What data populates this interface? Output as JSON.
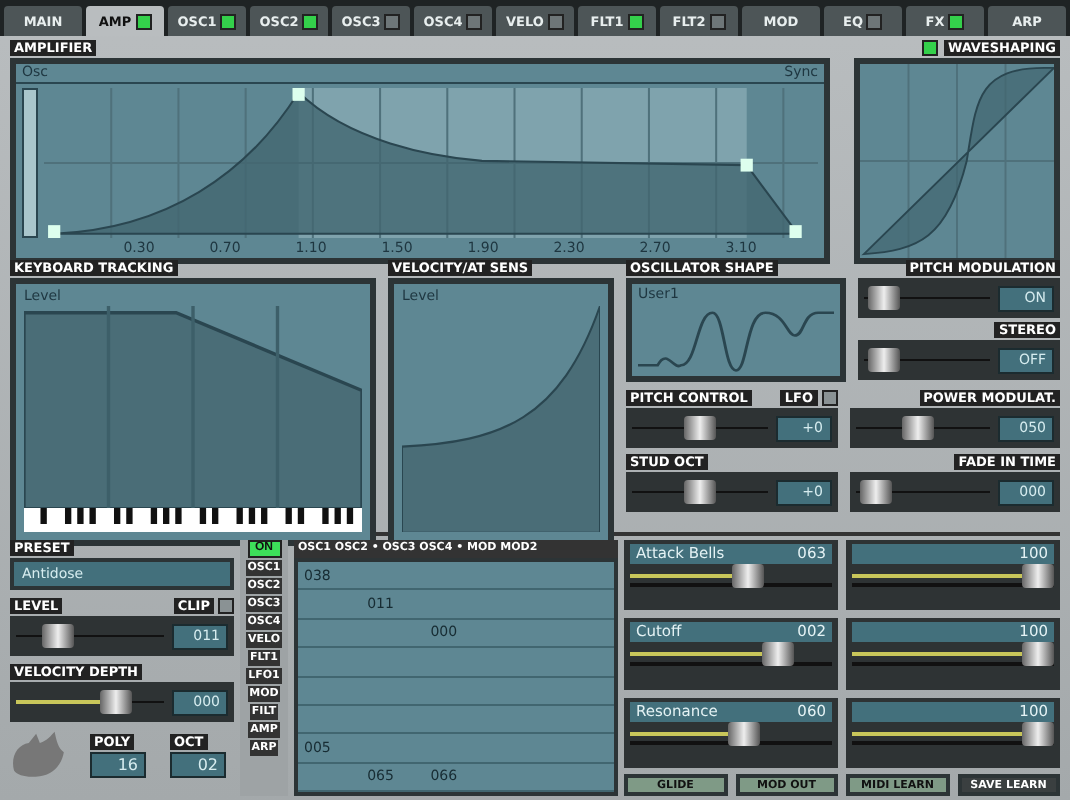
{
  "tabs": [
    {
      "label": "MAIN",
      "selected": false
    },
    {
      "label": "AMP",
      "selected": true,
      "toggle": true
    },
    {
      "label": "OSC1",
      "selected": false,
      "toggle": true
    },
    {
      "label": "OSC2",
      "selected": false,
      "toggle": true
    },
    {
      "label": "OSC3",
      "selected": false,
      "toggle": false
    },
    {
      "label": "OSC4",
      "selected": false,
      "toggle": false
    },
    {
      "label": "VELO",
      "selected": false,
      "toggle": false
    },
    {
      "label": "FLT1",
      "selected": false,
      "toggle": true
    },
    {
      "label": "FLT2",
      "selected": false,
      "toggle": false
    },
    {
      "label": "MOD",
      "selected": false
    },
    {
      "label": "EQ",
      "selected": false,
      "toggle": false
    },
    {
      "label": "FX",
      "selected": false,
      "toggle": true
    },
    {
      "label": "ARP",
      "selected": false
    }
  ],
  "amplifier": {
    "title": "AMPLIFIER",
    "envelope_label": "Osc",
    "sync_label": "Sync",
    "time_labels": [
      "0.30",
      "0.70",
      "1.10",
      "1.50",
      "1.90",
      "2.30",
      "2.70",
      "3.10"
    ]
  },
  "waveshaping": {
    "title": "WAVESHAPING",
    "enabled": true
  },
  "keyboard_tracking": {
    "title": "KEYBOARD TRACKING",
    "curve_label": "Level"
  },
  "velocity": {
    "title": "VELOCITY/AT SENS",
    "curve_label": "Level"
  },
  "oscillator_shape": {
    "title": "OSCILLATOR SHAPE",
    "name": "User1"
  },
  "right_sliders": [
    {
      "title": "PITCH MODULATION",
      "level": 0.04,
      "value": "ON"
    },
    {
      "title": "STEREO",
      "level": 0.04,
      "value": "OFF"
    }
  ],
  "mid_sliders": [
    {
      "title": "PITCH CONTROL",
      "level": 0.5,
      "value": "+0",
      "lfo_label": "LFO",
      "lfo": false
    },
    {
      "title": "STUD OCT",
      "level": 0.5,
      "value": "+0"
    }
  ],
  "mod_sliders": [
    {
      "title": "POWER MODULAT.",
      "level": 0.45,
      "value": "050"
    },
    {
      "title": "FADE IN TIME",
      "level": 0.04,
      "value": "000"
    }
  ],
  "preset": {
    "title": "PRESET",
    "name": "Antidose"
  },
  "level_slider": {
    "title": "LEVEL",
    "level": 0.22,
    "value": "011",
    "clip_label": "CLIP",
    "clip": false
  },
  "velocity_depth": {
    "title": "VELOCITY DEPTH",
    "level": 0.72,
    "value": "000"
  },
  "small_values": [
    {
      "label": "POLY",
      "value": "16"
    },
    {
      "label": "OCT",
      "value": "02"
    }
  ],
  "step_toggle": {
    "label": "ON",
    "on": true
  },
  "step_list": [
    "OSC1",
    "OSC2",
    "OSC3",
    "OSC4",
    "VELO",
    "FLT1",
    "LFO1",
    "MOD",
    "FILT",
    "AMP",
    "ARP"
  ],
  "grid": {
    "header": "OSC1 OSC2 • OSC3 OSC4 • MOD MOD2",
    "rows": [
      {
        "column_1": "038"
      },
      {
        "column_2": "011"
      },
      {
        "column_3": "000"
      },
      {},
      {},
      {},
      {
        "column_1": "005"
      },
      {
        "column_2": "065",
        "column_3": "066"
      }
    ]
  },
  "knobs": [
    [
      {
        "label": "Attack Bells",
        "value": "063",
        "level": 0.6
      },
      {
        "value": "100",
        "level": 1
      }
    ],
    [
      {
        "label": "Cutoff",
        "value": "002",
        "level": 0.78
      },
      {
        "value": "100",
        "level": 1
      }
    ],
    [
      {
        "label": "Resonance",
        "value": "060",
        "level": 0.58
      },
      {
        "value": "100",
        "level": 1
      }
    ]
  ],
  "buttons": [
    {
      "label": "GLIDE",
      "selected": false
    },
    {
      "label": "MOD OUT",
      "selected": false
    },
    {
      "label": "MIDI LEARN",
      "selected": false
    },
    {
      "label": "SAVE LEARN",
      "selected": true
    }
  ]
}
